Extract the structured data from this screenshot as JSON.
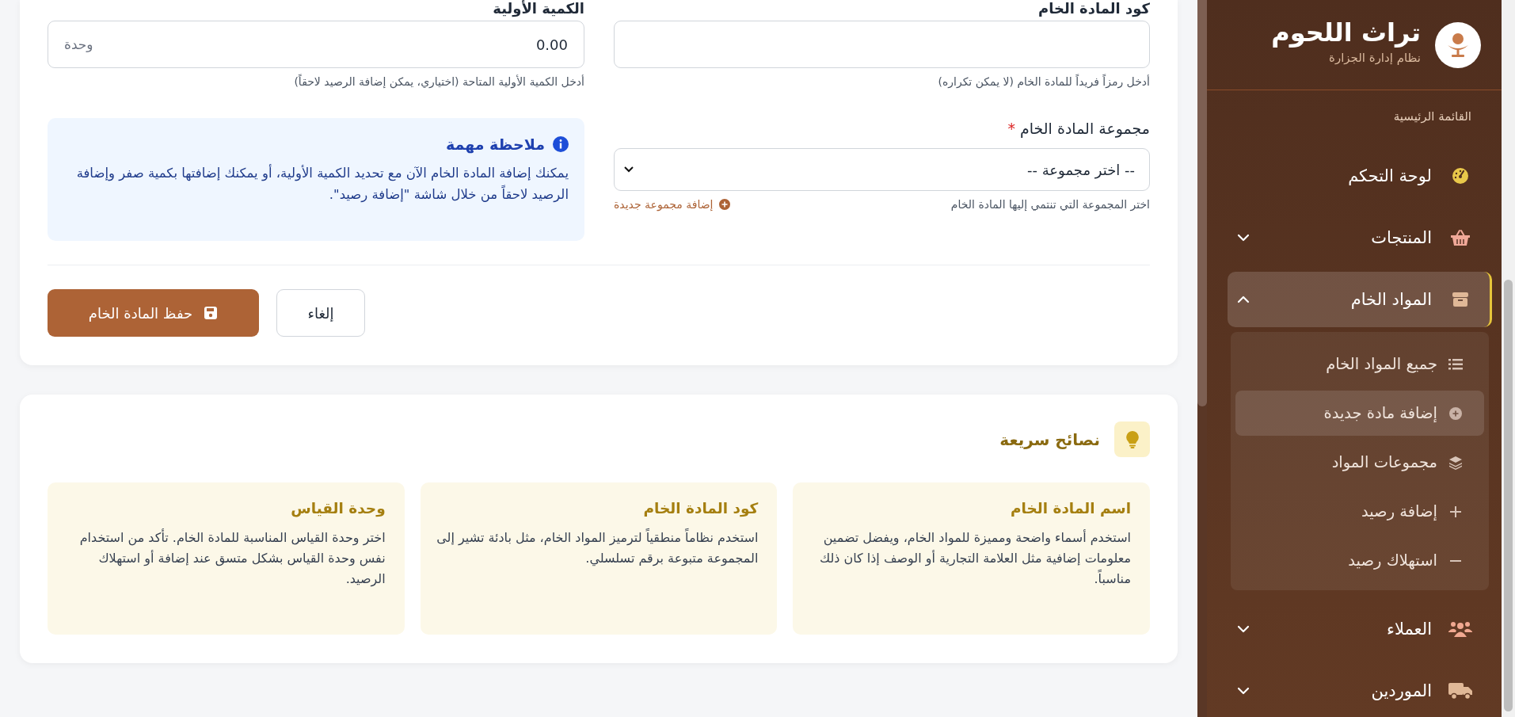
{
  "form": {
    "code_field": {
      "label": "كود المادة الخام",
      "help": "أدخل رمزاً فريداً للمادة الخام (لا يمكن تكراره)"
    },
    "quantity_field": {
      "label": "الكمية الأولية",
      "value": "0.00",
      "unit": "وحدة",
      "help": "أدخل الكمية الأولية المتاحة (اختياري، يمكن إضافة الرصيد لاحقاً)"
    },
    "group_field": {
      "label": "مجموعة المادة الخام",
      "required_mark": "*",
      "value": "-- اختر مجموعة --",
      "help": "اختر المجموعة التي تنتمي إليها المادة الخام",
      "add_link": "إضافة مجموعة جديدة"
    },
    "note": {
      "title": "ملاحظة مهمة",
      "text": "يمكنك إضافة المادة الخام الآن مع تحديد الكمية الأولية، أو يمكنك إضافتها بكمية صفر وإضافة الرصيد لاحقاً من خلال شاشة \"إضافة رصيد\"."
    },
    "buttons": [
      {
        "label": "إلغاء",
        "kind": "secondary"
      },
      {
        "label": "حفظ المادة الخام",
        "kind": "primary"
      }
    ]
  },
  "tips": {
    "title": "نصائح سريعة",
    "items": [
      {
        "title": "اسم المادة الخام",
        "text": "استخدم أسماء واضحة ومميزة للمواد الخام، ويفضل تضمين معلومات إضافية مثل العلامة التجارية أو الوصف إذا كان ذلك مناسباً."
      },
      {
        "title": "كود المادة الخام",
        "text": "استخدم نظاماً منطقياً لترميز المواد الخام، مثل بادئة تشير إلى المجموعة متبوعة برقم تسلسلي."
      },
      {
        "title": "وحدة القياس",
        "text": "اختر وحدة القياس المناسبة للمادة الخام. تأكد من استخدام نفس وحدة القياس بشكل متسق عند إضافة أو استهلاك الرصيد."
      }
    ]
  },
  "sidebar": {
    "brand": {
      "title": "تراث اللحوم",
      "subtitle": "نظام إدارة الجزارة"
    },
    "section_label": "القائمة الرئيسية",
    "items": [
      {
        "label": "لوحة التحكم",
        "kind": "gauge",
        "selected": false
      },
      {
        "label": "المنتجات",
        "kind": "basket",
        "selected": false,
        "expanded": false
      },
      {
        "label": "المواد الخام",
        "kind": "box",
        "selected": true,
        "expanded": true,
        "children": [
          {
            "label": "جميع المواد الخام",
            "kind": "list",
            "selected": false
          },
          {
            "label": "إضافة مادة جديدة",
            "kind": "add",
            "selected": true
          },
          {
            "label": "مجموعات المواد",
            "kind": "layers",
            "selected": false
          },
          {
            "label": "إضافة رصيد",
            "kind": "plus",
            "selected": false
          },
          {
            "label": "استهلاك رصيد",
            "kind": "minus",
            "selected": false
          }
        ]
      },
      {
        "label": "العملاء",
        "kind": "users",
        "selected": false,
        "expanded": false
      },
      {
        "label": "الموردين",
        "kind": "truck",
        "selected": false,
        "expanded": false
      }
    ]
  }
}
